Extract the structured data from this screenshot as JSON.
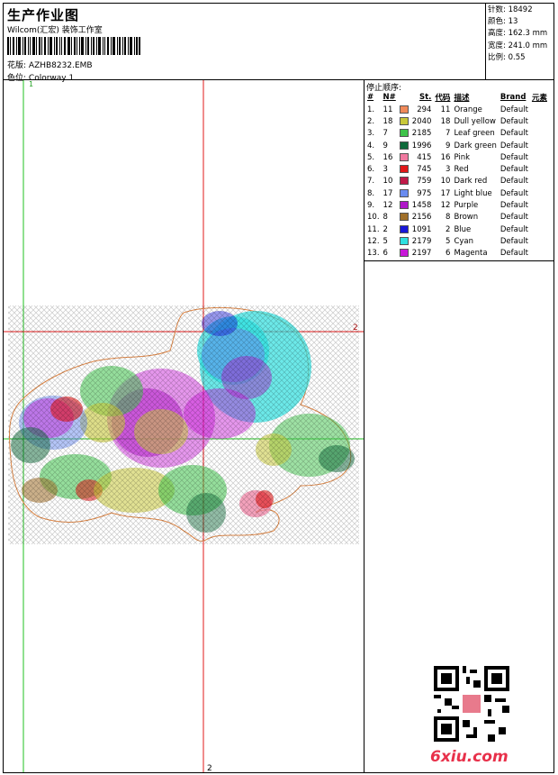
{
  "header": {
    "title": "生产作业图",
    "studio": "Wilcom(汇宏) 装饰工作室",
    "design_label": "花版:",
    "design_value": "AZHB8232.EMB",
    "colorway_label": "色位:",
    "colorway_value": "Colorway 1"
  },
  "stats": {
    "stitches_label": "针数:",
    "stitches": "18492",
    "colors_label": "颜色:",
    "colors": "13",
    "height_label": "高度:",
    "height": "162.3 mm",
    "width_label": "宽度:",
    "width": "241.0 mm",
    "scale_label": "比例:",
    "scale": "0.55"
  },
  "canvas": {
    "guide1_label": "1",
    "guide2_label_right": "2",
    "guide2_label_bottom": "2"
  },
  "stop_sequence": {
    "title": "停止顺序:",
    "columns": [
      "#",
      "N#",
      "St.",
      "代码",
      "描述",
      "Brand",
      "元素"
    ],
    "rows": [
      {
        "n": "1.",
        "nn": "11",
        "color": "#f08a5a",
        "st": "294",
        "code": "11",
        "desc": "Orange",
        "brand": "Default"
      },
      {
        "n": "2.",
        "nn": "18",
        "color": "#c8c83a",
        "st": "2040",
        "code": "18",
        "desc": "Dull yellow",
        "brand": "Default"
      },
      {
        "n": "3.",
        "nn": "7",
        "color": "#3ec34a",
        "st": "2185",
        "code": "7",
        "desc": "Leaf green",
        "brand": "Default"
      },
      {
        "n": "4.",
        "nn": "9",
        "color": "#0e6a3a",
        "st": "1996",
        "code": "9",
        "desc": "Dark green",
        "brand": "Default"
      },
      {
        "n": "5.",
        "nn": "16",
        "color": "#f07aa0",
        "st": "415",
        "code": "16",
        "desc": "Pink",
        "brand": "Default"
      },
      {
        "n": "6.",
        "nn": "3",
        "color": "#e01818",
        "st": "745",
        "code": "3",
        "desc": "Red",
        "brand": "Default"
      },
      {
        "n": "7.",
        "nn": "10",
        "color": "#c01a48",
        "st": "759",
        "code": "10",
        "desc": "Dark red",
        "brand": "Default"
      },
      {
        "n": "8.",
        "nn": "17",
        "color": "#6a8cf0",
        "st": "975",
        "code": "17",
        "desc": "Light blue",
        "brand": "Default"
      },
      {
        "n": "9.",
        "nn": "12",
        "color": "#b018c8",
        "st": "1458",
        "code": "12",
        "desc": "Purple",
        "brand": "Default"
      },
      {
        "n": "10.",
        "nn": "8",
        "color": "#a0702a",
        "st": "2156",
        "code": "8",
        "desc": "Brown",
        "brand": "Default"
      },
      {
        "n": "11.",
        "nn": "2",
        "color": "#1818d8",
        "st": "1091",
        "code": "2",
        "desc": "Blue",
        "brand": "Default"
      },
      {
        "n": "12.",
        "nn": "5",
        "color": "#2ee0e0",
        "st": "2179",
        "code": "5",
        "desc": "Cyan",
        "brand": "Default"
      },
      {
        "n": "13.",
        "nn": "6",
        "color": "#c818d8",
        "st": "2197",
        "code": "6",
        "desc": "Magenta",
        "brand": "Default"
      }
    ]
  },
  "watermark": {
    "logo_text": "6xiu.com",
    "qr_icon": "qr-code-icon"
  }
}
